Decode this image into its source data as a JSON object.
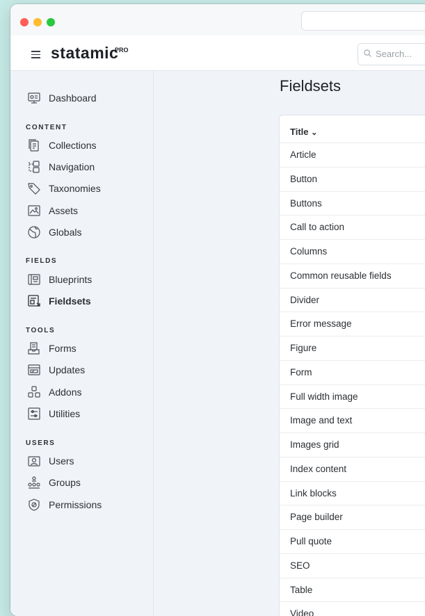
{
  "app": {
    "logo": "statamic",
    "logo_badge": "PRO",
    "search_placeholder": "Search..."
  },
  "sidebar": {
    "top": [
      {
        "label": "Dashboard",
        "icon": "dashboard-icon"
      }
    ],
    "sections": [
      {
        "title": "CONTENT",
        "items": [
          {
            "label": "Collections",
            "icon": "collections-icon"
          },
          {
            "label": "Navigation",
            "icon": "navigation-icon"
          },
          {
            "label": "Taxonomies",
            "icon": "tag-icon"
          },
          {
            "label": "Assets",
            "icon": "image-icon"
          },
          {
            "label": "Globals",
            "icon": "globe-icon"
          }
        ]
      },
      {
        "title": "FIELDS",
        "items": [
          {
            "label": "Blueprints",
            "icon": "blueprint-icon"
          },
          {
            "label": "Fieldsets",
            "icon": "fieldset-icon",
            "active": true
          }
        ]
      },
      {
        "title": "TOOLS",
        "items": [
          {
            "label": "Forms",
            "icon": "form-icon"
          },
          {
            "label": "Updates",
            "icon": "updates-icon"
          },
          {
            "label": "Addons",
            "icon": "addons-icon"
          },
          {
            "label": "Utilities",
            "icon": "utilities-icon"
          }
        ]
      },
      {
        "title": "USERS",
        "items": [
          {
            "label": "Users",
            "icon": "users-icon"
          },
          {
            "label": "Groups",
            "icon": "groups-icon"
          },
          {
            "label": "Permissions",
            "icon": "permissions-icon"
          }
        ]
      }
    ]
  },
  "main": {
    "title": "Fieldsets",
    "table": {
      "column_title": "Title",
      "sort_indicator": "⌄",
      "rows": [
        "Article",
        "Button",
        "Buttons",
        "Call to action",
        "Columns",
        "Common reusable fields",
        "Divider",
        "Error message",
        "Figure",
        "Form",
        "Full width image",
        "Image and text",
        "Images grid",
        "Index content",
        "Link blocks",
        "Page builder",
        "Pull quote",
        "SEO",
        "Table",
        "Video"
      ]
    }
  }
}
